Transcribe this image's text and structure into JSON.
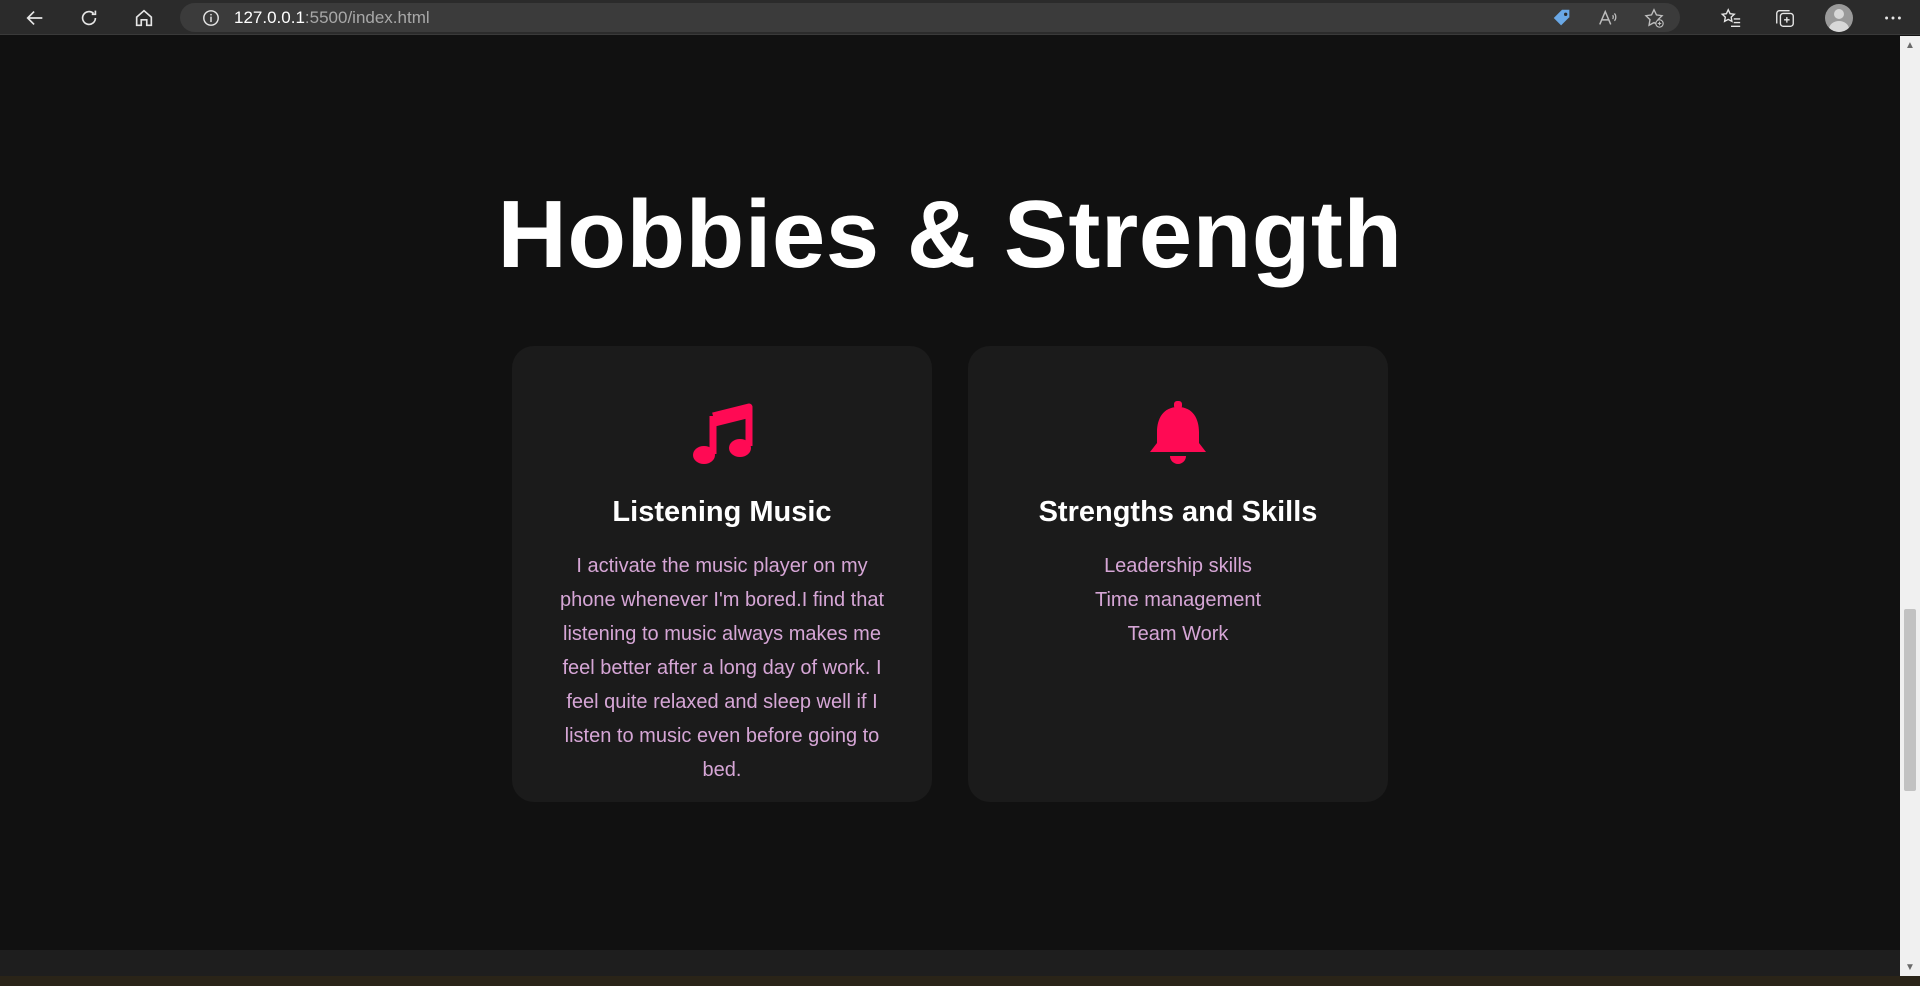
{
  "browser": {
    "url_host": "127.0.0.1",
    "url_path": ":5500/index.html"
  },
  "page": {
    "section_title": "Hobbies & Strength",
    "cards": [
      {
        "icon": "music-note-icon",
        "title": "Listening Music",
        "text": "I activate the music player on my phone whenever I'm bored.I find that listening to music always makes me feel better after a long day of work. I feel quite relaxed and sleep well if I listen to music even before going to bed."
      },
      {
        "icon": "bell-icon",
        "title": "Strengths and Skills",
        "skills": [
          "Leadership skills",
          "Time management",
          "Team Work"
        ]
      }
    ]
  },
  "colors": {
    "background": "#111111",
    "card_background": "#1b1b1b",
    "accent": "#ff0a54",
    "body_text": "#d6a6d6",
    "heading": "#ffffff"
  }
}
